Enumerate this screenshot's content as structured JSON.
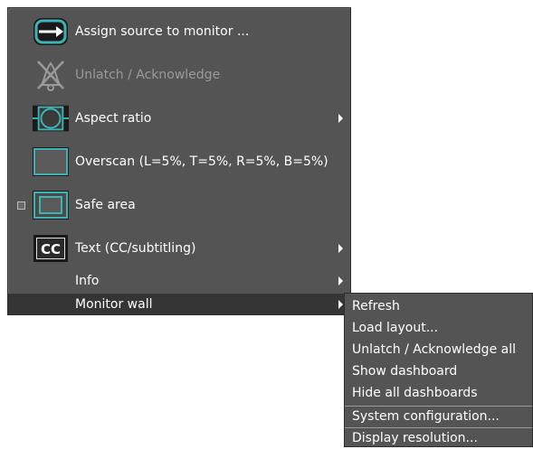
{
  "context_menu": {
    "items": [
      {
        "label": "Assign source to monitor ...",
        "icon": "assign-source-icon",
        "enabled": true,
        "submenu": false
      },
      {
        "label": "Unlatch / Acknowledge",
        "icon": "unlatch-icon",
        "enabled": false,
        "submenu": false
      },
      {
        "label": "Aspect ratio",
        "icon": "aspect-ratio-icon",
        "enabled": true,
        "submenu": true
      },
      {
        "label": "Overscan (L=5%, T=5%, R=5%, B=5%)",
        "icon": "overscan-icon",
        "enabled": true,
        "submenu": false
      },
      {
        "label": "Safe area",
        "icon": "safe-area-icon",
        "enabled": true,
        "submenu": false,
        "checkbox": false
      },
      {
        "label": "Text (CC/subtitling)",
        "icon": "cc-icon",
        "enabled": true,
        "submenu": true
      },
      {
        "label": "Info",
        "enabled": true,
        "submenu": true
      },
      {
        "label": "Monitor wall",
        "enabled": true,
        "submenu": true,
        "selected": true
      }
    ],
    "cc_icon_text": "CC"
  },
  "monitor_wall_submenu": {
    "items": [
      {
        "label": "Refresh"
      },
      {
        "label": "Load layout..."
      },
      {
        "label": "Unlatch / Acknowledge all"
      },
      {
        "label": "Show dashboard"
      },
      {
        "label": "Hide all dashboards"
      },
      {
        "label": "System configuration..."
      },
      {
        "label": "Display resolution..."
      }
    ]
  },
  "colors": {
    "menu_bg": "#545454",
    "selected_bg": "#353535",
    "accent_teal": "#3fb3b3",
    "text": "#ffffff",
    "disabled_text": "#9a9a9a"
  }
}
